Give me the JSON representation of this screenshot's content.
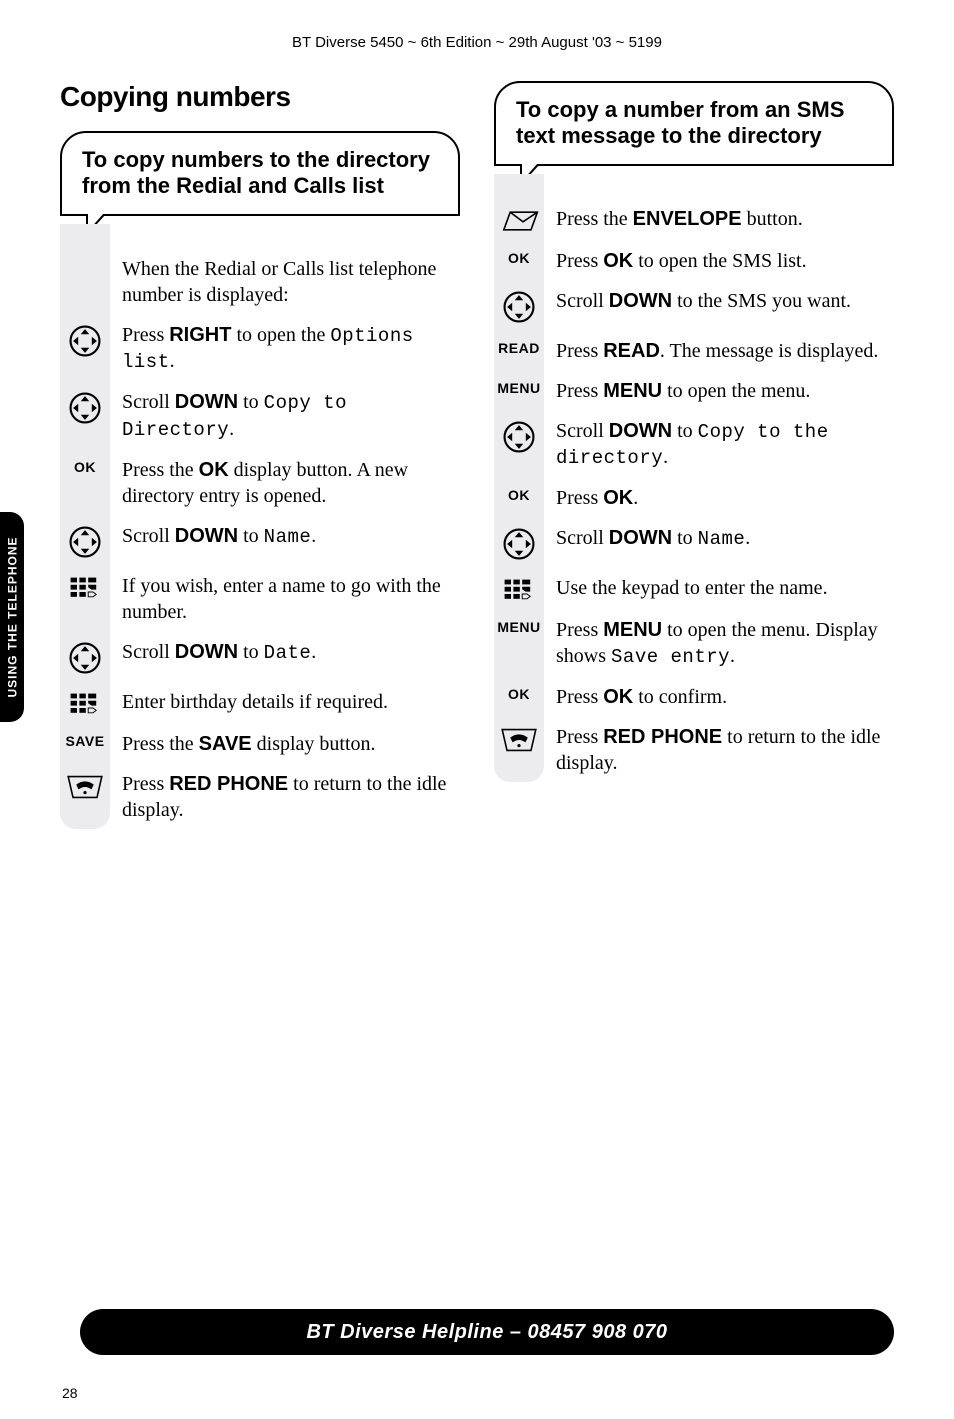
{
  "header": "BT Diverse 5450 ~ 6th Edition ~ 29th August '03 ~ 5199",
  "side_tab": "USING THE TELEPHONE",
  "page_number": "28",
  "footer": "BT Diverse Helpline – 08457 908 070",
  "left": {
    "title": "Copying numbers",
    "callout": "To copy numbers to the directory from the Redial and Calls list",
    "steps": [
      {
        "icon": "",
        "body": "When the Redial or Calls list telephone number is displayed:"
      },
      {
        "icon": "nav-right",
        "body_pre": "Press ",
        "bold": "RIGHT",
        "body_post": " to open the ",
        "lcd": "Options list",
        "body_end": "."
      },
      {
        "icon": "nav-down",
        "body_pre": "Scroll ",
        "bold": "DOWN",
        "body_post": " to ",
        "lcd": "Copy to Directory",
        "body_end": "."
      },
      {
        "icon": "OK",
        "body_pre": "Press the ",
        "bold": "OK",
        "body_post": " display button. A new directory entry is opened."
      },
      {
        "icon": "nav-down",
        "body_pre": "Scroll ",
        "bold": "DOWN",
        "body_post": " to ",
        "lcd": "Name",
        "body_end": "."
      },
      {
        "icon": "keypad",
        "body": "If you wish, enter a name to go with the number."
      },
      {
        "icon": "nav-down",
        "body_pre": "Scroll ",
        "bold": "DOWN",
        "body_post": " to ",
        "lcd": "Date",
        "body_end": "."
      },
      {
        "icon": "keypad",
        "body": "Enter birthday details if required."
      },
      {
        "icon": "SAVE",
        "body_pre": "Press the ",
        "bold": "SAVE",
        "body_post": " display button."
      },
      {
        "icon": "redphone",
        "body_pre": "Press ",
        "bold": "RED PHONE",
        "body_post": " to return to the idle display."
      }
    ]
  },
  "right": {
    "callout": "To copy a number from an SMS text message to the directory",
    "steps": [
      {
        "icon": "envelope",
        "body_pre": "Press the ",
        "bold": "ENVELOPE",
        "body_post": " button."
      },
      {
        "icon": "OK",
        "body_pre": "Press ",
        "bold": "OK",
        "body_post": " to open the SMS list."
      },
      {
        "icon": "nav-down",
        "body_pre": "Scroll ",
        "bold": "DOWN",
        "body_post": " to the SMS you want."
      },
      {
        "icon": "READ",
        "body_pre": "Press ",
        "bold": "READ",
        "body_post": ". The message is displayed."
      },
      {
        "icon": "MENU",
        "body_pre": "Press ",
        "bold": "MENU",
        "body_post": " to open the menu."
      },
      {
        "icon": "nav-down",
        "body_pre": "Scroll ",
        "bold": "DOWN",
        "body_post": " to ",
        "lcd": "Copy to the directory",
        "body_end": "."
      },
      {
        "icon": "OK",
        "body_pre": "Press ",
        "bold": "OK",
        "body_post": "."
      },
      {
        "icon": "nav-down",
        "body_pre": "Scroll ",
        "bold": "DOWN",
        "body_post": " to ",
        "lcd": "Name",
        "body_end": "."
      },
      {
        "icon": "keypad",
        "body": "Use the keypad to enter the name."
      },
      {
        "icon": "MENU",
        "body_pre": "Press ",
        "bold": "MENU",
        "body_post": " to open the menu. Display shows ",
        "lcd": "Save entry",
        "body_end": "."
      },
      {
        "icon": "OK",
        "body_pre": "Press ",
        "bold": "OK",
        "body_post": " to confirm."
      },
      {
        "icon": "redphone",
        "body_pre": "Press ",
        "bold": "RED PHONE",
        "body_post": " to return to the idle display."
      }
    ]
  }
}
